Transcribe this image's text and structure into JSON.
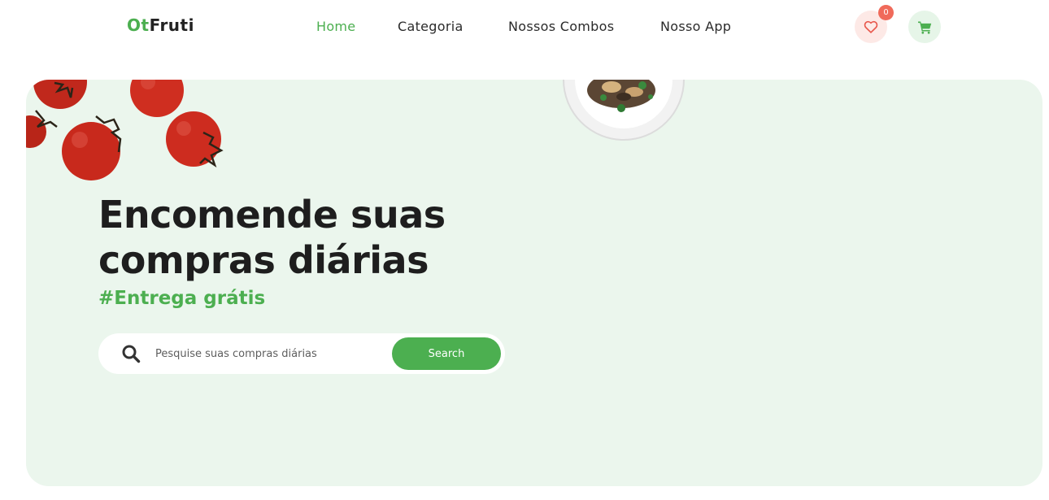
{
  "header": {
    "logo_accent": "Ot",
    "logo_rest": "Fruti",
    "nav": [
      {
        "label": "Home",
        "active": true
      },
      {
        "label": "Categoria",
        "active": false
      },
      {
        "label": "Nossos Combos",
        "active": false
      },
      {
        "label": "Nosso App",
        "active": false
      }
    ],
    "wishlist": {
      "icon": "heart-icon",
      "count": "0"
    },
    "cart": {
      "icon": "cart-icon"
    }
  },
  "hero": {
    "headline_line1": "Encomende suas",
    "headline_line2": "compras diárias",
    "tagline": "#Entrega grátis",
    "search": {
      "placeholder": "Pesquise suas compras diárias",
      "value": "",
      "button_label": "Search"
    },
    "images": [
      "tomatoes-image",
      "food-plate-image"
    ]
  },
  "colors": {
    "accent": "#4caf50",
    "hero_bg": "#ebf6ed",
    "badge": "#f06a5a",
    "text_dark": "#1e1e1e"
  }
}
